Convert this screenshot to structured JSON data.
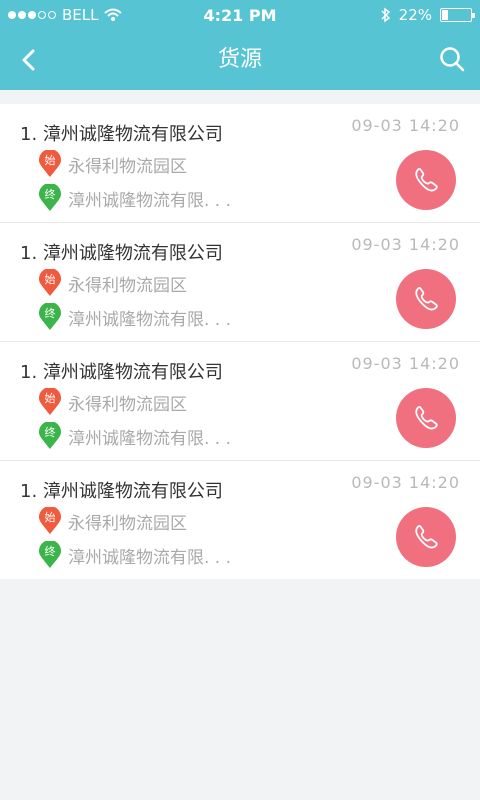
{
  "status_bar": {
    "carrier": "BELL",
    "time": "4:21 PM",
    "battery_percent": "22%",
    "battery_level": 0.22,
    "signal_bars_filled": 3,
    "signal_bars_total": 5
  },
  "header": {
    "title": "货源",
    "back_icon": "back-chevron-icon",
    "search_icon": "search-icon",
    "accent_color": "#56c4d3"
  },
  "pins": {
    "start_label": "始",
    "end_label": "终",
    "start_color": "#f05a3e",
    "end_color": "#3bb54a"
  },
  "items": [
    {
      "company": "1. 漳州诚隆物流有限公司",
      "time": "09-03 14:20",
      "origin": "永得利物流园区",
      "destination": "漳州诚隆物流有限. . ."
    },
    {
      "company": "1. 漳州诚隆物流有限公司",
      "time": "09-03 14:20",
      "origin": "永得利物流园区",
      "destination": "漳州诚隆物流有限. . ."
    },
    {
      "company": "1. 漳州诚隆物流有限公司",
      "time": "09-03 14:20",
      "origin": "永得利物流园区",
      "destination": "漳州诚隆物流有限. . ."
    },
    {
      "company": "1. 漳州诚隆物流有限公司",
      "time": "09-03 14:20",
      "origin": "永得利物流园区",
      "destination": "漳州诚隆物流有限. . ."
    }
  ],
  "call_button_color": "#f1707f"
}
